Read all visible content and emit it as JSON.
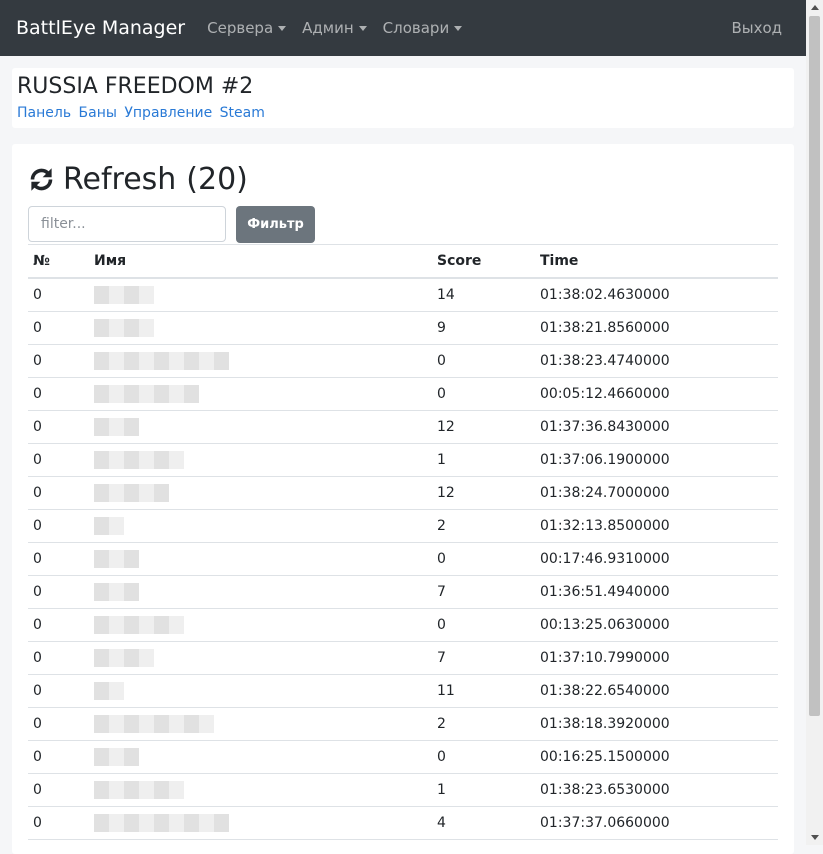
{
  "navbar": {
    "brand": "BattlEye Manager",
    "menus": [
      {
        "label": "Сервера"
      },
      {
        "label": "Админ"
      },
      {
        "label": "Словари"
      }
    ],
    "logout": "Выход"
  },
  "server": {
    "title": "RUSSIA FREEDOM #2",
    "links": [
      "Панель",
      "Баны",
      "Управление",
      "Steam"
    ]
  },
  "players": {
    "refresh_label": "Refresh",
    "count_text": "(20)",
    "filter_placeholder": "filter...",
    "filter_button": "Фильтр",
    "columns": [
      "№",
      "Имя",
      "Score",
      "Time"
    ],
    "rows": [
      {
        "num": "0",
        "score": "14",
        "time": "01:38:02.4630000"
      },
      {
        "num": "0",
        "score": "9",
        "time": "01:38:21.8560000"
      },
      {
        "num": "0",
        "score": "0",
        "time": "01:38:23.4740000"
      },
      {
        "num": "0",
        "score": "0",
        "time": "00:05:12.4660000"
      },
      {
        "num": "0",
        "score": "12",
        "time": "01:37:36.8430000"
      },
      {
        "num": "0",
        "score": "1",
        "time": "01:37:06.1900000"
      },
      {
        "num": "0",
        "score": "12",
        "time": "01:38:24.7000000"
      },
      {
        "num": "0",
        "score": "2",
        "time": "01:32:13.8500000"
      },
      {
        "num": "0",
        "score": "0",
        "time": "00:17:46.9310000"
      },
      {
        "num": "0",
        "score": "7",
        "time": "01:36:51.4940000"
      },
      {
        "num": "0",
        "score": "0",
        "time": "00:13:25.0630000"
      },
      {
        "num": "0",
        "score": "7",
        "time": "01:37:10.7990000"
      },
      {
        "num": "0",
        "score": "11",
        "time": "01:38:22.6540000"
      },
      {
        "num": "0",
        "score": "2",
        "time": "01:38:18.3920000"
      },
      {
        "num": "0",
        "score": "0",
        "time": "00:16:25.1500000"
      },
      {
        "num": "0",
        "score": "1",
        "time": "01:38:23.6530000"
      },
      {
        "num": "0",
        "score": "4",
        "time": "01:37:37.0660000"
      }
    ]
  },
  "colors": {
    "navbar": "#343a40",
    "link": "#2a7ad6",
    "button": "#6c757d"
  }
}
